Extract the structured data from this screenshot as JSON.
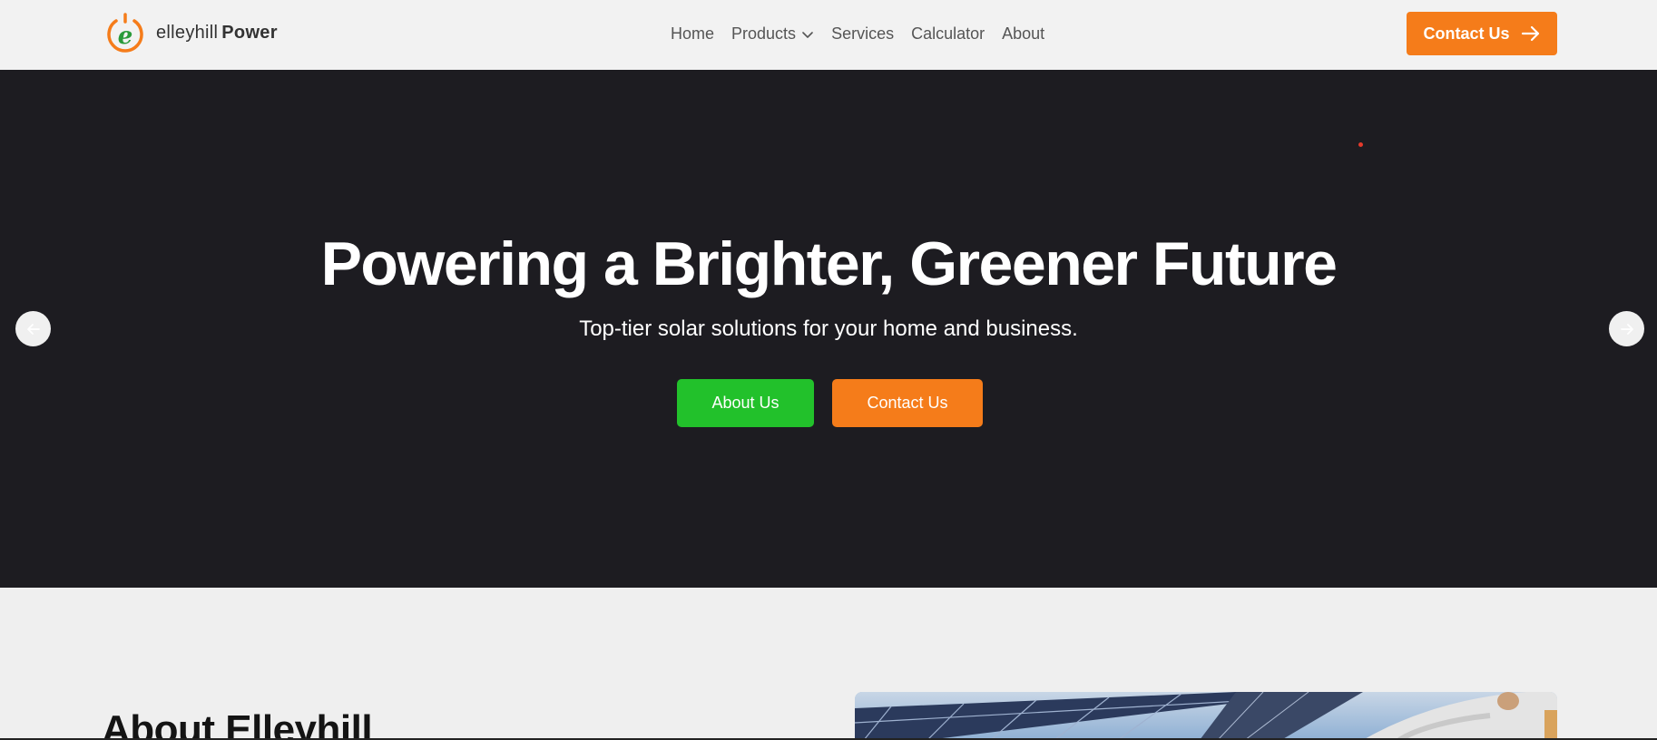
{
  "brand": {
    "name_light": "elleyhill",
    "name_bold": "Power",
    "colors": {
      "orange": "#f57c1a",
      "green": "#22c12b",
      "dark": "#1d1c21"
    }
  },
  "nav": {
    "items": [
      {
        "label": "Home"
      },
      {
        "label": "Products",
        "has_dropdown": true
      },
      {
        "label": "Services"
      },
      {
        "label": "Calculator"
      },
      {
        "label": "About"
      }
    ]
  },
  "header": {
    "cta_label": "Contact Us",
    "cta_icon": "arrow-right-icon"
  },
  "hero": {
    "title": "Powering a Brighter, Greener Future",
    "subtitle": "Top-tier solar solutions for your home and business.",
    "primary_button": "About Us",
    "secondary_button": "Contact Us",
    "prev_icon": "arrow-left-icon",
    "next_icon": "arrow-right-icon"
  },
  "about": {
    "heading": "About Elleyhill"
  }
}
